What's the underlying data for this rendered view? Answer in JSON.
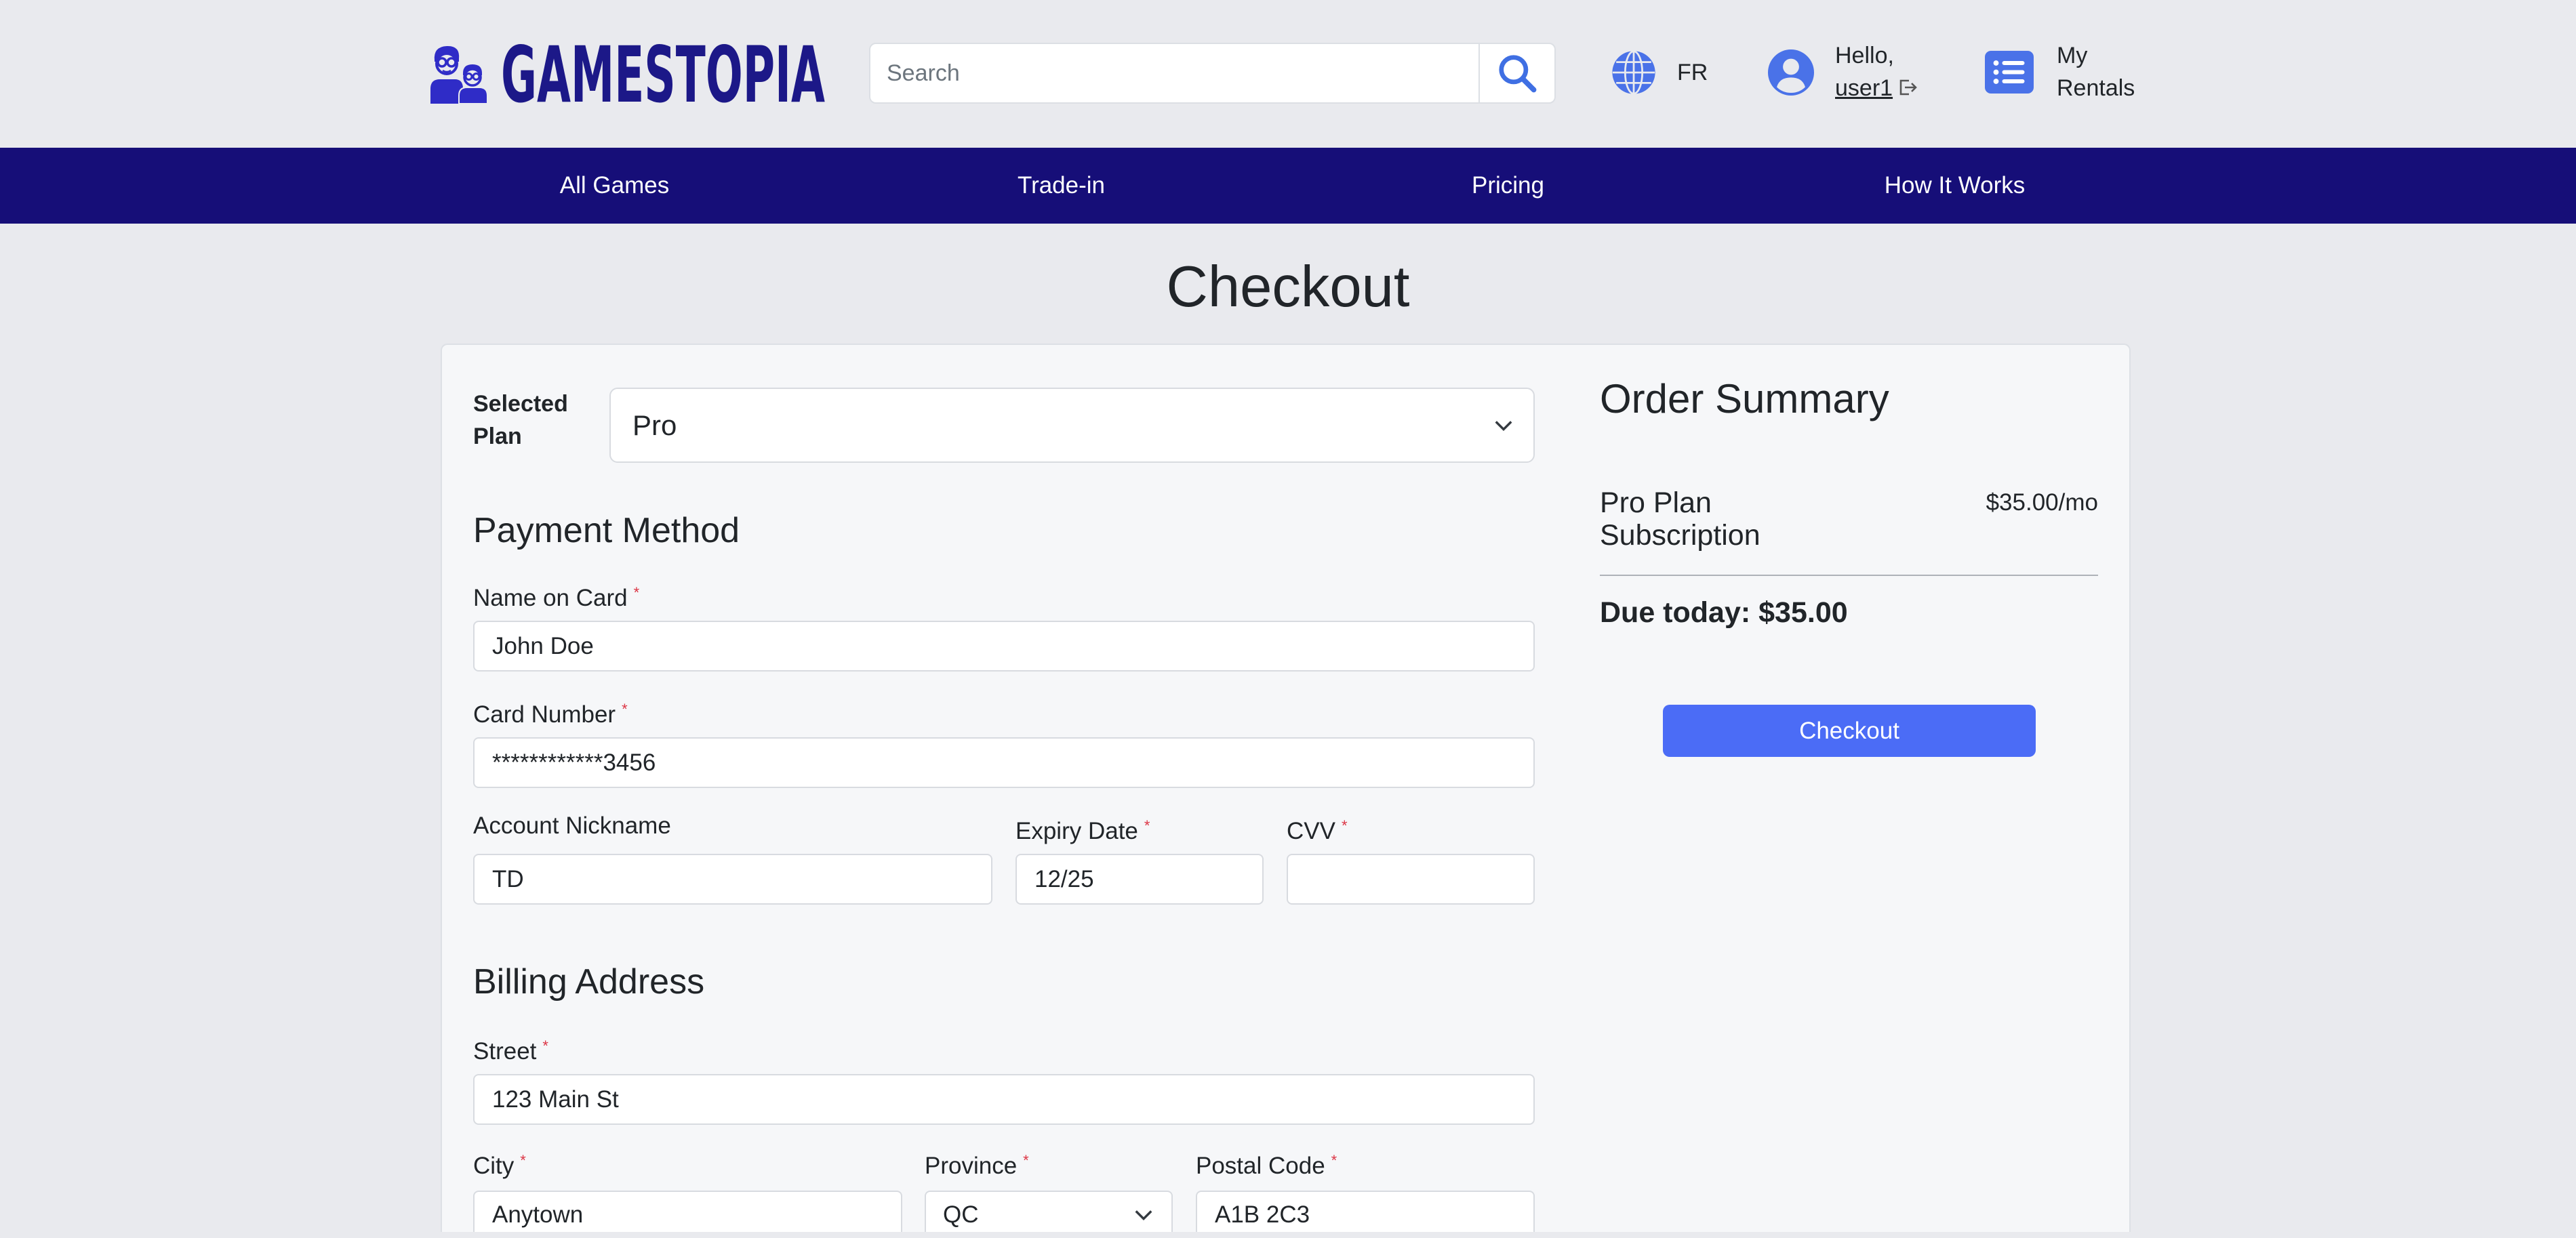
{
  "colors": {
    "page_bg": "#e9eaee",
    "nav_bg": "#160e78",
    "accent": "#4b6cf6",
    "icon": "#4a72e8",
    "brand": "#1c1888",
    "logo_mark": "#2f2cc7",
    "required": "#dc3545",
    "card_bg": "#f6f7f9"
  },
  "brand": {
    "name": "GAMESTOPIA",
    "logo_icon": "gamers-logo-icon"
  },
  "search": {
    "placeholder": "Search",
    "icon": "search-icon"
  },
  "language": {
    "icon": "globe-icon",
    "label": "FR"
  },
  "account": {
    "icon": "user-circle-icon",
    "greeting": "Hello,",
    "username": "user1",
    "logout_icon": "logout-icon"
  },
  "rentals": {
    "icon": "list-icon",
    "label": "My Rentals"
  },
  "nav": {
    "items": [
      {
        "label": "All Games"
      },
      {
        "label": "Trade-in"
      },
      {
        "label": "Pricing"
      },
      {
        "label": "How It Works"
      }
    ]
  },
  "page": {
    "title": "Checkout"
  },
  "form": {
    "required_mark": "*",
    "dropdown_icon": "chevron-down-icon",
    "plan": {
      "label": "Selected Plan",
      "value": "Pro"
    },
    "payment": {
      "heading": "Payment Method",
      "name_on_card": {
        "label": "Name on Card",
        "required": true,
        "value": "John Doe"
      },
      "card_number": {
        "label": "Card Number",
        "required": true,
        "value": "************3456"
      },
      "account_nickname": {
        "label": "Account Nickname",
        "required": false,
        "value": "TD"
      },
      "expiry_date": {
        "label": "Expiry Date",
        "required": true,
        "value": "12/25"
      },
      "cvv": {
        "label": "CVV",
        "required": true,
        "value": ""
      }
    },
    "billing": {
      "heading": "Billing Address",
      "street": {
        "label": "Street",
        "required": true,
        "value": "123 Main St"
      },
      "city": {
        "label": "City",
        "required": true,
        "value": "Anytown"
      },
      "province": {
        "label": "Province",
        "required": true,
        "value": "QC"
      },
      "postal_code": {
        "label": "Postal Code",
        "required": true,
        "value": "A1B 2C3"
      }
    }
  },
  "summary": {
    "heading": "Order Summary",
    "item_name": "Pro Plan Subscription",
    "item_price": "$35.00/mo",
    "due_today": "Due today: $35.00",
    "checkout_button": "Checkout"
  }
}
